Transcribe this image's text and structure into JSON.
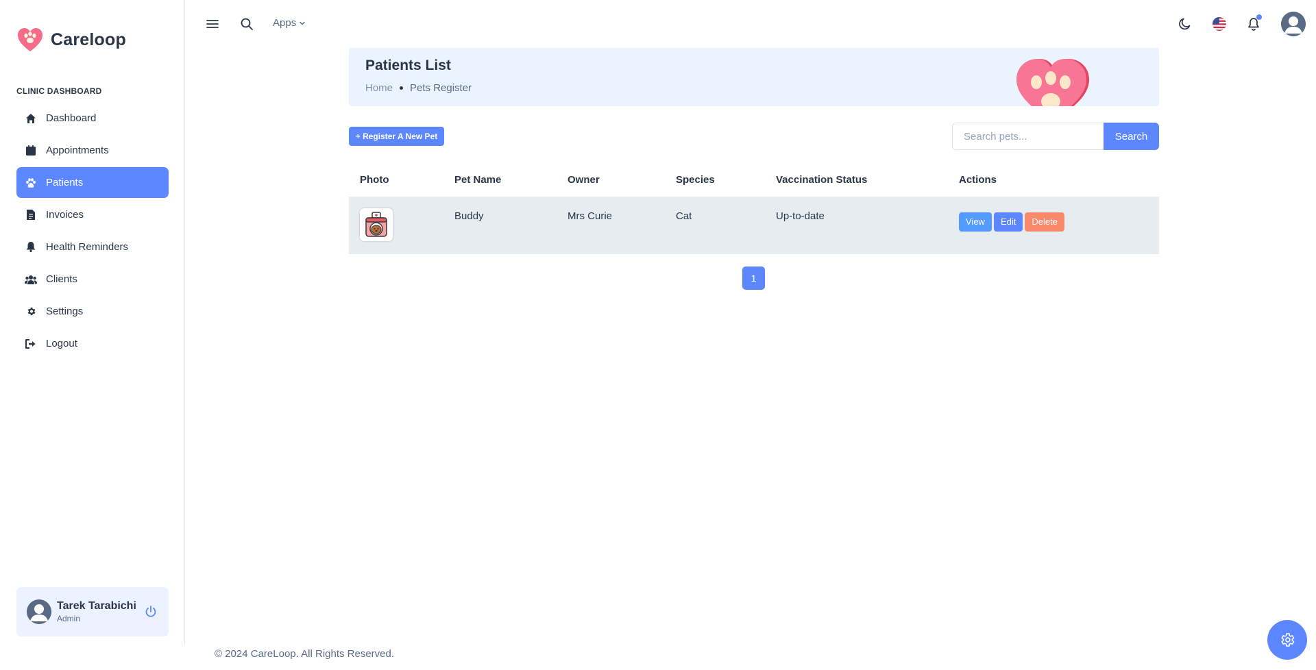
{
  "brand": {
    "name": "Careloop",
    "logo_icon": "heart-paw-icon",
    "accent": "#5d87ff"
  },
  "sidebar": {
    "section_label": "CLINIC DASHBOARD",
    "items": [
      {
        "label": "Dashboard",
        "icon": "home-icon"
      },
      {
        "label": "Appointments",
        "icon": "calendar-icon"
      },
      {
        "label": "Patients",
        "icon": "paw-icon",
        "active": true
      },
      {
        "label": "Invoices",
        "icon": "invoice-icon"
      },
      {
        "label": "Health Reminders",
        "icon": "bell-icon"
      },
      {
        "label": "Clients",
        "icon": "users-icon"
      },
      {
        "label": "Settings",
        "icon": "gear-icon"
      },
      {
        "label": "Logout",
        "icon": "logout-icon"
      }
    ],
    "profile": {
      "name": "Tarek Tarabichi",
      "role": "Admin"
    }
  },
  "topbar": {
    "apps_label": "Apps",
    "icons": [
      "menu-icon",
      "search-icon",
      "moon-icon",
      "us-flag-icon",
      "bell-icon",
      "avatar"
    ]
  },
  "banner": {
    "title": "Patients List",
    "breadcrumb": {
      "home": "Home",
      "current": "Pets Register"
    }
  },
  "toolbar": {
    "register_label": "+ Register A New Pet",
    "search_placeholder": "Search pets...",
    "search_label": "Search"
  },
  "table": {
    "headers": [
      "Photo",
      "Pet Name",
      "Owner",
      "Species",
      "Vaccination Status",
      "Actions"
    ],
    "rows": [
      {
        "pet_name": "Buddy",
        "owner": "Mrs Curie",
        "species": "Cat",
        "vaccination_status": "Up-to-date",
        "photo_icon": "pet-carrier-icon"
      }
    ],
    "actions": {
      "view": "View",
      "edit": "Edit",
      "delete": "Delete"
    }
  },
  "pagination": {
    "current_page": "1"
  },
  "footer": {
    "text": "© 2024 CareLoop. All Rights Reserved."
  }
}
